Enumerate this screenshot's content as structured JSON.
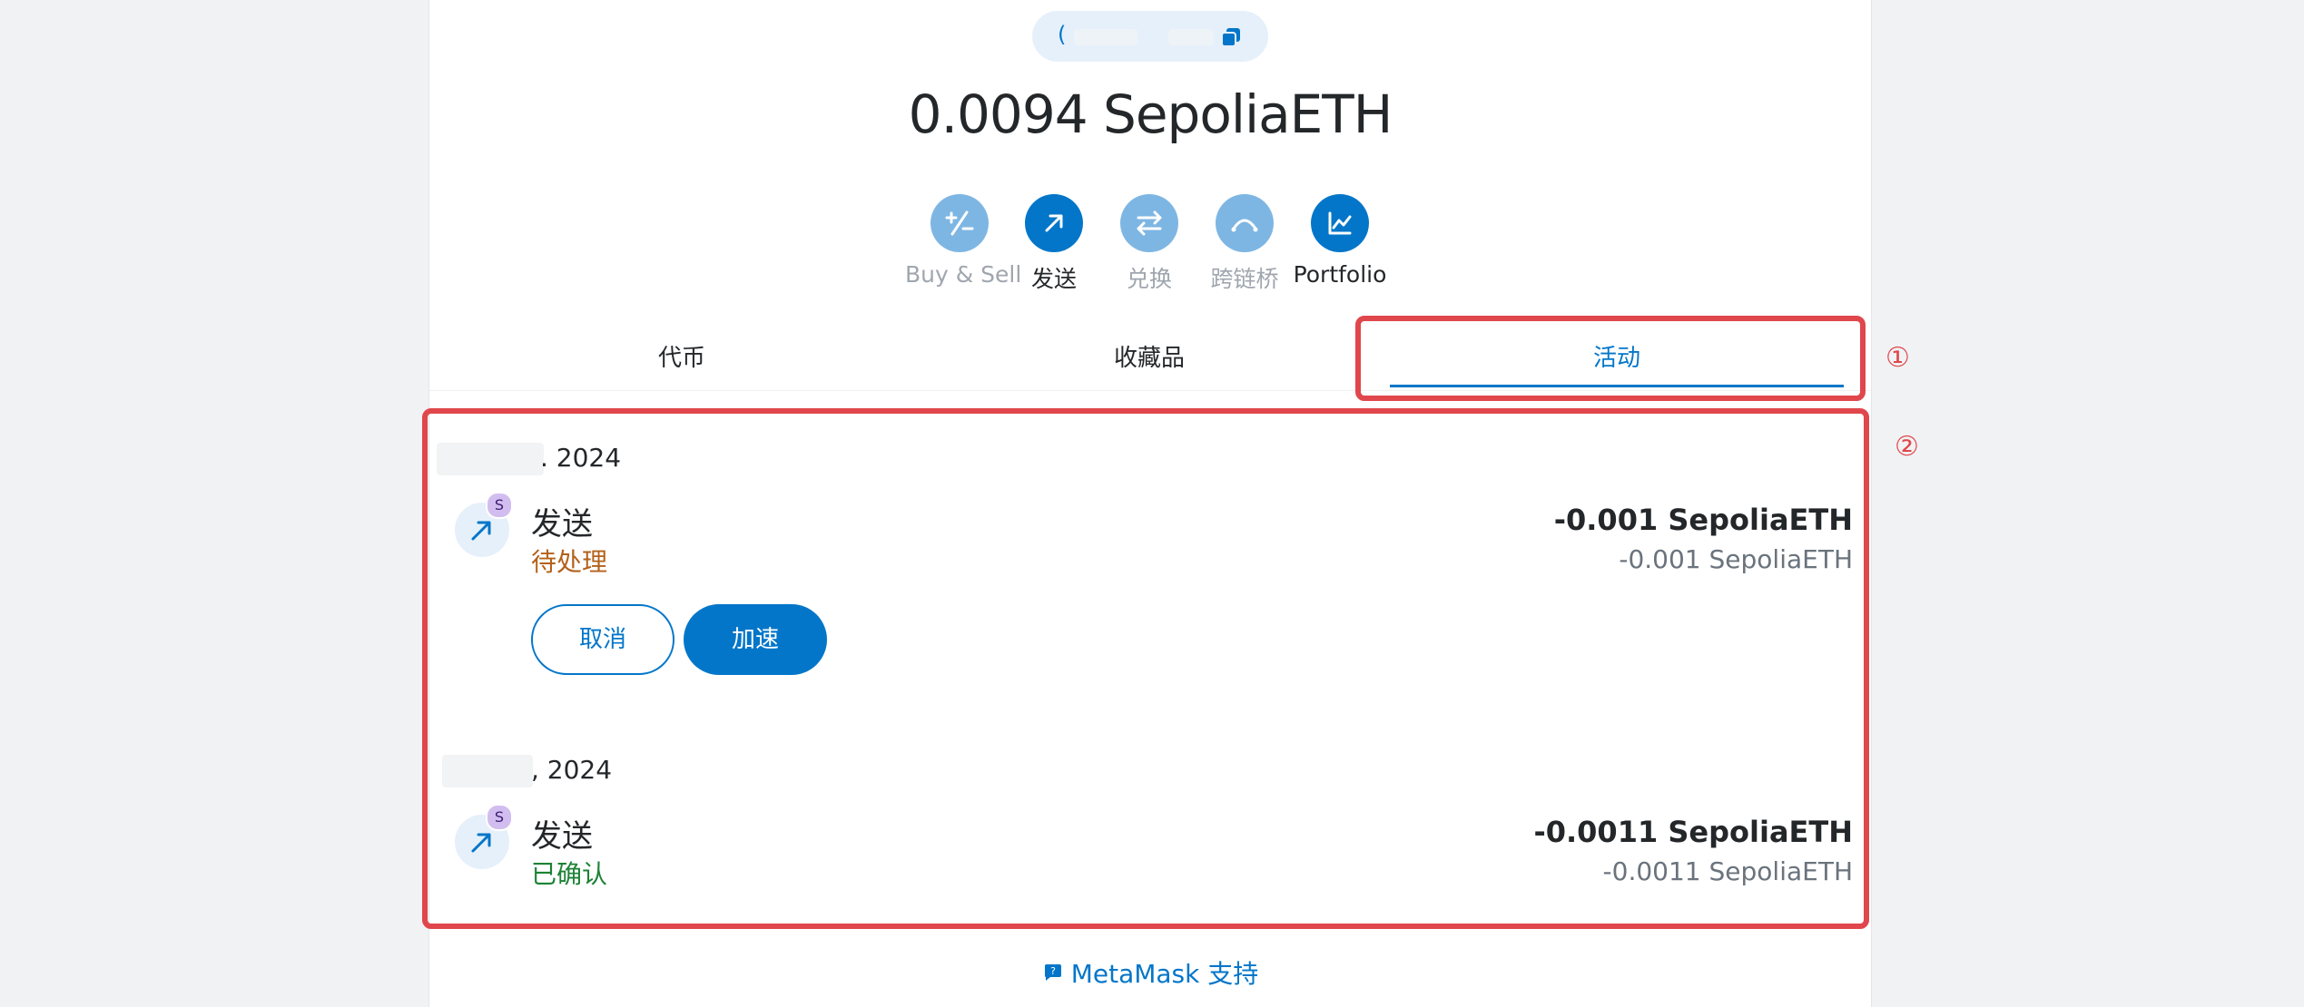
{
  "account": {
    "address_visible": "(",
    "balance": "0.0094 SepoliaETH"
  },
  "actions": [
    {
      "label": "Buy & Sell",
      "icon": "plus-minus-icon",
      "enabled": false
    },
    {
      "label": "发送",
      "icon": "arrow-up-right-icon",
      "enabled": true
    },
    {
      "label": "兑换",
      "icon": "swap-icon",
      "enabled": false
    },
    {
      "label": "跨链桥",
      "icon": "bridge-icon",
      "enabled": false
    },
    {
      "label": "Portfolio",
      "icon": "chart-icon",
      "enabled": true
    }
  ],
  "tabs": [
    {
      "label": "代币"
    },
    {
      "label": "收藏品"
    },
    {
      "label": "活动"
    }
  ],
  "annotations": {
    "one": "①",
    "two": "②"
  },
  "activity": {
    "groups": [
      {
        "date_suffix": ". 2024",
        "tx": {
          "type": "发送",
          "status": "待处理",
          "amount": "-0.001 SepoliaETH",
          "amount_sub": "-0.001 SepoliaETH",
          "badge": "S",
          "cancel_label": "取消",
          "speedup_label": "加速"
        }
      },
      {
        "date_suffix": ", 2024",
        "tx": {
          "type": "发送",
          "status": "已确认",
          "amount": "-0.0011 SepoliaETH",
          "amount_sub": "-0.0011 SepoliaETH",
          "badge": "S"
        }
      }
    ]
  },
  "footer": {
    "support_label": "MetaMask 支持"
  },
  "colors": {
    "primary": "#0376c9",
    "pending": "#b3611b",
    "confirmed": "#1c8234",
    "annotation": "#e0474c"
  }
}
